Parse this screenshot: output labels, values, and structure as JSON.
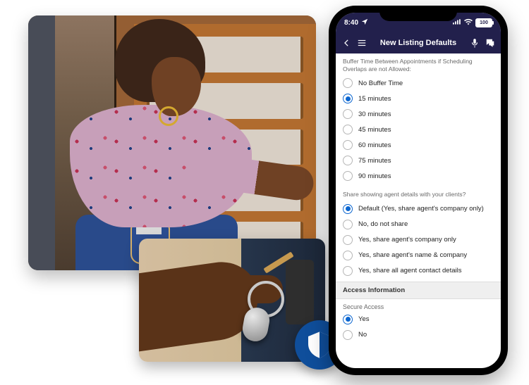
{
  "status": {
    "time": "8:40",
    "battery_label": "100"
  },
  "header": {
    "title": "New Listing Defaults"
  },
  "buffer": {
    "label": "Buffer Time Between Appointments if Scheduling Overlaps are not Allowed:",
    "options": [
      "No Buffer Time",
      "15 minutes",
      "30 minutes",
      "45 minutes",
      "60 minutes",
      "75 minutes",
      "90 minutes"
    ],
    "selected_index": 1
  },
  "share": {
    "label": "Share showing agent details with your clients?",
    "options": [
      "Default (Yes, share agent's company only)",
      "No, do not share",
      "Yes, share agent's company only",
      "Yes, share agent's name & company",
      "Yes, share all agent contact details"
    ],
    "selected_index": 0
  },
  "access": {
    "header": "Access Information",
    "secure_label": "Secure Access",
    "options": [
      "Yes",
      "No"
    ],
    "selected_index": 0
  }
}
